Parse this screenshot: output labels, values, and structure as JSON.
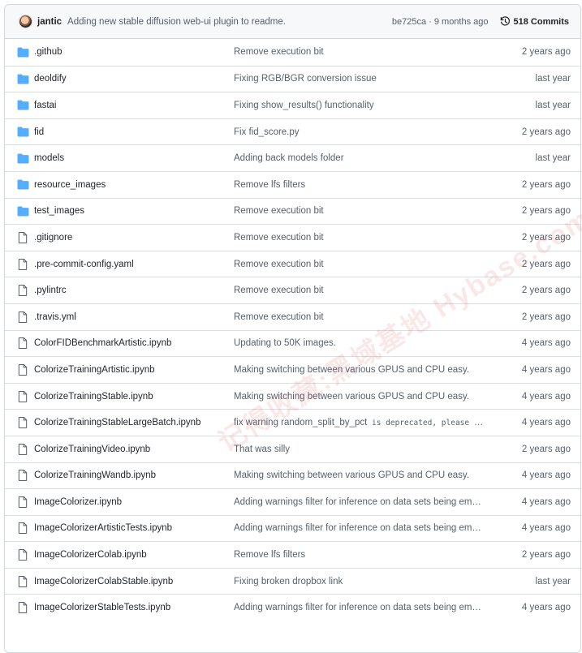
{
  "header": {
    "author": "jantic",
    "message": "Adding new stable diffusion web-ui plugin to readme.",
    "meta": "be725ca · 9 months ago",
    "commits_label": "518 Commits"
  },
  "files": [
    {
      "type": "folder",
      "name": ".github",
      "message": "Remove execution bit",
      "age": "2 years ago"
    },
    {
      "type": "folder",
      "name": "deoldify",
      "message": "Fixing RGB/BGR conversion issue",
      "age": "last year"
    },
    {
      "type": "folder",
      "name": "fastai",
      "message": "Fixing show_results() functionality",
      "age": "last year"
    },
    {
      "type": "folder",
      "name": "fid",
      "message": "Fix fid_score.py",
      "age": "2 years ago"
    },
    {
      "type": "folder",
      "name": "models",
      "message": "Adding back models folder",
      "age": "last year"
    },
    {
      "type": "folder",
      "name": "resource_images",
      "message": "Remove lfs filters",
      "age": "2 years ago"
    },
    {
      "type": "folder",
      "name": "test_images",
      "message": "Remove execution bit",
      "age": "2 years ago"
    },
    {
      "type": "file",
      "name": ".gitignore",
      "message": "Remove execution bit",
      "age": "2 years ago"
    },
    {
      "type": "file",
      "name": ".pre-commit-config.yaml",
      "message": "Remove execution bit",
      "age": "2 years ago"
    },
    {
      "type": "file",
      "name": ".pylintrc",
      "message": "Remove execution bit",
      "age": "2 years ago"
    },
    {
      "type": "file",
      "name": ".travis.yml",
      "message": "Remove execution bit",
      "age": "2 years ago"
    },
    {
      "type": "file",
      "name": "ColorFIDBenchmarkArtistic.ipynb",
      "message": "Updating to 50K images.",
      "age": "4 years ago"
    },
    {
      "type": "file",
      "name": "ColorizeTrainingArtistic.ipynb",
      "message": "Making switching between various GPUS and CPU easy.",
      "age": "4 years ago"
    },
    {
      "type": "file",
      "name": "ColorizeTrainingStable.ipynb",
      "message": "Making switching between various GPUS and CPU easy.",
      "age": "4 years ago"
    },
    {
      "type": "file",
      "name": "ColorizeTrainingStableLargeBatch.ipynb",
      "message": "fix warning random_split_by_pct",
      "message_code": " is deprecated, please use…",
      "age": "4 years ago"
    },
    {
      "type": "file",
      "name": "ColorizeTrainingVideo.ipynb",
      "message": "That was silly",
      "age": "2 years ago"
    },
    {
      "type": "file",
      "name": "ColorizeTrainingWandb.ipynb",
      "message": "Making switching between various GPUS and CPU easy.",
      "age": "4 years ago"
    },
    {
      "type": "file",
      "name": "ImageColorizer.ipynb",
      "message": "Adding warnings filter for inference on data sets being empt…",
      "age": "4 years ago"
    },
    {
      "type": "file",
      "name": "ImageColorizerArtisticTests.ipynb",
      "message": "Adding warnings filter for inference on data sets being empt…",
      "age": "4 years ago"
    },
    {
      "type": "file",
      "name": "ImageColorizerColab.ipynb",
      "message": "Remove lfs filters",
      "age": "2 years ago"
    },
    {
      "type": "file",
      "name": "ImageColorizerColabStable.ipynb",
      "message": "Fixing broken dropbox link",
      "age": "last year"
    },
    {
      "type": "file",
      "name": "ImageColorizerStableTests.ipynb",
      "message": "Adding warnings filter for inference on data sets being empt…",
      "age": "4 years ago"
    }
  ],
  "colors": {
    "folder": "#54aeff",
    "file": "#57606a"
  },
  "watermark_text": "记得收藏:黑域基地 Hybase.com"
}
